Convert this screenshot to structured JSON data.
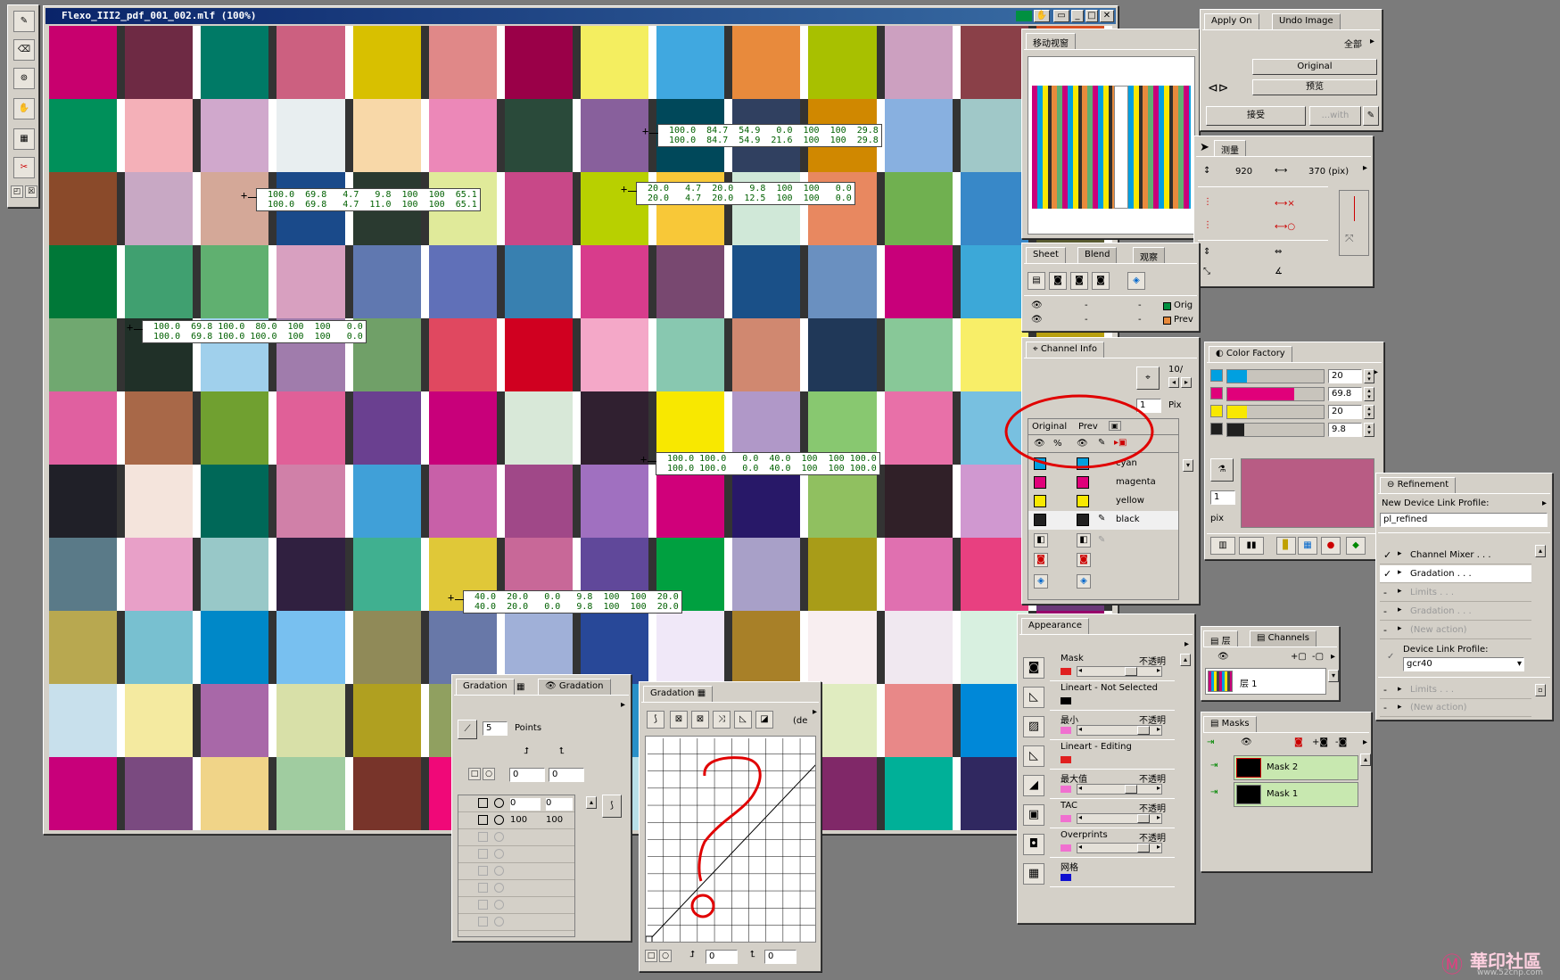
{
  "main_window": {
    "title": "Flexo_III2_pdf_001_002.mlf (100%)",
    "patches": [
      [
        "#c8006e",
        "#6e2a44",
        "#007a66",
        "#cc6080",
        "#d8c000",
        "#e08888",
        "#9a0048",
        "#f4ee60",
        "#40a8e0",
        "#e88a3c",
        "#a8c000",
        "#cca0c0",
        "#8a4048",
        "#d84e20"
      ],
      [
        "#00905a",
        "#f4b0b8",
        "#d0a8cc",
        "#e8eef0",
        "#f8d8a8",
        "#ec88b8",
        "#2a4a3a",
        "#88609c",
        "#00485a",
        "#304060",
        "#d08800",
        "#88b0e0",
        "#a0c8c8",
        "#e87060"
      ],
      [
        "#8a4a2a",
        "#c8a8c4",
        "#d4a898",
        "#1a4a8a",
        "#2a3a30",
        "#e0ea9a",
        "#c84888",
        "#b8d000",
        "#f8c838",
        "#d0e8d8",
        "#e88860",
        "#70b050",
        "#3888c8",
        "#585a30"
      ],
      [
        "#007838",
        "#40a070",
        "#60b070",
        "#d8a0c0",
        "#6078b0",
        "#6070b8",
        "#3880b0",
        "#d83c8c",
        "#784870",
        "#1a5088",
        "#6a90c0",
        "#c8007a",
        "#3ca8d8",
        "#80603a"
      ],
      [
        "#70a870",
        "#203028",
        "#a0d0ec",
        "#a07cac",
        "#70a068",
        "#e04860",
        "#d00020",
        "#f4a8c8",
        "#88c8b0",
        "#d08870",
        "#203858",
        "#88c898",
        "#f8ee68",
        "#b8a010"
      ],
      [
        "#e060a0",
        "#a86848",
        "#70a030",
        "#e06098",
        "#6a4090",
        "#c8007a",
        "#d8e8d8",
        "#302030",
        "#f8e800",
        "#b098c8",
        "#88c870",
        "#e870a8",
        "#78c0e0",
        "#e8c8d0"
      ],
      [
        "#202028",
        "#f4e4dc",
        "#006858",
        "#d080a8",
        "#40a0d8",
        "#c860a8",
        "#a04888",
        "#a070c0",
        "#d0007a",
        "#281868",
        "#90c060",
        "#302028",
        "#d098d0",
        "#a8c8e8"
      ],
      [
        "#5a7a88",
        "#e8a0c8",
        "#98c8c8",
        "#302040",
        "#40b090",
        "#e0c838",
        "#c86898",
        "#60489a",
        "#00a040",
        "#a8a0c8",
        "#a89c18",
        "#e070b0",
        "#e84080",
        "#6a3878"
      ],
      [
        "#b8a850",
        "#78c0d0",
        "#0088c8",
        "#78c0f0",
        "#908a58",
        "#6878a8",
        "#a0b0d8",
        "#284898",
        "#f0e8f8",
        "#a88028",
        "#f8eef0",
        "#f0e8f0",
        "#d8f0e0",
        "#98006a"
      ],
      [
        "#c8e0ec",
        "#f4eaa0",
        "#a868a8",
        "#d8e0a8",
        "#b0a020",
        "#90a060",
        "#e8d8e8",
        "#2890c8",
        "#e8c0d8",
        "#f0f0f0",
        "#e0ecc0",
        "#e88888",
        "#0088d8",
        "#c02058"
      ],
      [
        "#c8007a",
        "#7a4a80",
        "#f0d488",
        "#a0cca0",
        "#78342a",
        "#f00878",
        "#6a1e2a",
        "#b8e0e8",
        "#f0f0f8",
        "#e8e8f8",
        "#802868",
        "#00b098",
        "#302860",
        "#c0a8b0"
      ]
    ],
    "readouts": [
      {
        "row1": "100.0  69.8   4.7   9.8  100  100  65.1",
        "row2": "100.0  69.8   4.7  11.0  100  100  65.1"
      },
      {
        "row1": "100.0  84.7  54.9   0.0  100  100  29.8",
        "row2": "100.0  84.7  54.9  21.6  100  100  29.8"
      },
      {
        "row1": "20.0   4.7  20.0   9.8  100  100   0.0",
        "row2": "20.0   4.7  20.0  12.5  100  100   0.0"
      },
      {
        "row1": "100.0  69.8 100.0  80.0  100  100   0.0",
        "row2": "100.0  69.8 100.0 100.0  100  100   0.0"
      },
      {
        "row1": "100.0 100.0   0.0  40.0  100  100 100.0",
        "row2": "100.0 100.0   0.0  40.0  100  100 100.0"
      },
      {
        "row1": "40.0  20.0   0.0   9.8  100  100  20.0",
        "row2": "40.0  20.0   0.0   9.8  100  100  20.0"
      }
    ]
  },
  "apply_panel": {
    "tabs": [
      "Apply On",
      "Undo Image"
    ],
    "scope": "全部",
    "original_button": "Original",
    "preview_button": "预览",
    "accept_button": "接受",
    "with_button": "...with"
  },
  "navigator_panel": {
    "tab": "移动视窗"
  },
  "measure_panel": {
    "tab": "测量",
    "height_value": "920",
    "width_value": "370 (pix)"
  },
  "sheet_panel": {
    "tabs": [
      "Sheet",
      "Blend",
      "观察"
    ],
    "legend": [
      "Orig",
      "Prev"
    ]
  },
  "channel_info_panel": {
    "tab": "Channel Info",
    "counter": "10/",
    "pix_value": "1",
    "pix_label": "Pix",
    "header_original": "Original",
    "header_prev": "Prev",
    "percent_label": "%",
    "channels": [
      {
        "name": "cyan",
        "color": "#00a0e0"
      },
      {
        "name": "magenta",
        "color": "#e0007a"
      },
      {
        "name": "yellow",
        "color": "#f8e800"
      },
      {
        "name": "black",
        "color": "#202020"
      }
    ]
  },
  "color_factory_panel": {
    "tab": "Color Factory",
    "sliders": [
      {
        "color": "#00a0e0",
        "value": "20",
        "fill": 0.2
      },
      {
        "color": "#e0007a",
        "value": "69.8",
        "fill": 0.698
      },
      {
        "color": "#f8e800",
        "value": "20",
        "fill": 0.2
      },
      {
        "color": "#202020",
        "value": "9.8",
        "fill": 0.098
      }
    ],
    "preview_color": "#b85c84",
    "pix_value": "1",
    "pix_label": "pix"
  },
  "refinement_panel": {
    "tab": "Refinement",
    "new_profile_label": "New Device Link Profile:",
    "new_profile_value": "pl_refined",
    "actions": [
      {
        "label": "Channel Mixer . . .",
        "checked": true
      },
      {
        "label": "Gradation . . .",
        "checked": true
      },
      {
        "label": "Limits . . .",
        "checked": false
      },
      {
        "label": "Gradation . . .",
        "checked": false
      },
      {
        "label": "(New action)",
        "checked": false
      }
    ],
    "device_profile_label": "Device Link Profile:",
    "device_profile_value": "gcr40",
    "actions2": [
      {
        "label": "Limits . . ."
      },
      {
        "label": "(New action)"
      }
    ]
  },
  "appearance_panel": {
    "tab": "Appearance",
    "rows": [
      {
        "label": "Mask",
        "opacity": "不透明",
        "swatch": "#e02020",
        "has_slider": true,
        "thumb": 0.72
      },
      {
        "label": "Lineart - Not Selected",
        "opacity": "",
        "swatch": "#000000",
        "has_slider": false
      },
      {
        "label": "最小",
        "opacity": "不透明",
        "swatch": "#f070d0",
        "has_slider": true,
        "thumb": 0.9
      },
      {
        "label": "Lineart - Editing",
        "opacity": "",
        "swatch": "#e02020",
        "has_slider": false
      },
      {
        "label": "最大值",
        "opacity": "不透明",
        "swatch": "#f070d0",
        "has_slider": true,
        "thumb": 0.72
      },
      {
        "label": "TAC",
        "opacity": "不透明",
        "swatch": "#f070d0",
        "has_slider": true,
        "thumb": 0.9
      },
      {
        "label": "Overprints",
        "opacity": "不透明",
        "swatch": "#f070d0",
        "has_slider": true,
        "thumb": 0.9
      },
      {
        "label": "网格",
        "opacity": "",
        "swatch": "#1010d0",
        "has_slider": false
      }
    ]
  },
  "layers_panel": {
    "tabs": [
      "层",
      "Channels"
    ],
    "layer_name": "层 1"
  },
  "masks_panel": {
    "tab": "Masks",
    "masks": [
      "Mask 2",
      "Mask 1"
    ]
  },
  "gradation_points_panel": {
    "tabs": [
      "Gradation",
      "Gradation"
    ],
    "points_value": "5",
    "points_label": "Points",
    "input_x": "0",
    "input_y": "0",
    "table": [
      [
        "0",
        "0"
      ],
      [
        "100",
        "100"
      ],
      [
        "",
        ""
      ],
      [
        "",
        ""
      ],
      [
        "",
        ""
      ],
      [
        "",
        ""
      ],
      [
        "",
        ""
      ],
      [
        "",
        ""
      ]
    ]
  },
  "gradation_curve_panel": {
    "tab": "Gradation",
    "de_label": "(de",
    "x_value": "0",
    "y_value": "0"
  },
  "watermark": {
    "text": "華印社區",
    "url": "www.52cnp.com"
  }
}
